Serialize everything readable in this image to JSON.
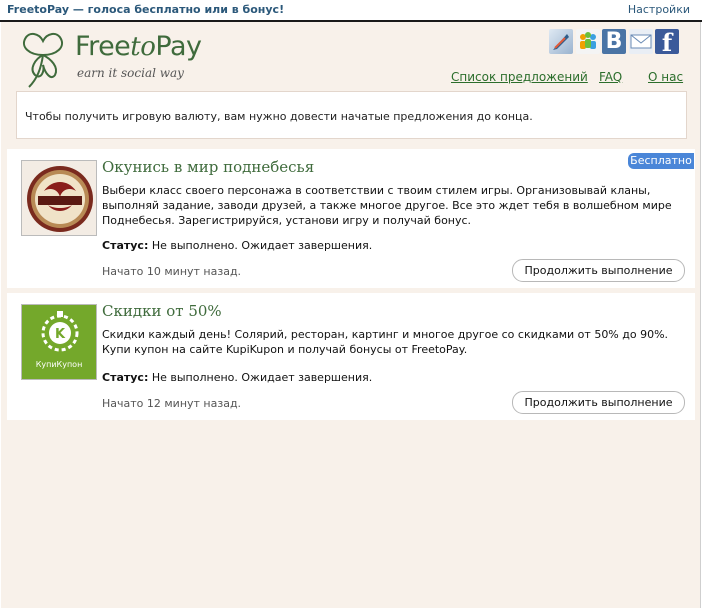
{
  "topbar": {
    "app_title": "FreetoPay — голоса бесплатно или в бонус!",
    "settings_link": "Настройки"
  },
  "header": {
    "logo_brand_prefix": "Free",
    "logo_brand_italic": "to",
    "logo_brand_suffix": "Pay",
    "logo_tagline": "earn it social way",
    "social_icons": [
      "feather-icon",
      "people-icon",
      "vk-icon",
      "mail-icon",
      "facebook-icon"
    ],
    "vk_letter": "B",
    "fb_letter": "f",
    "nav": {
      "offers": "Список предложений",
      "faq": "FAQ",
      "about": "О нас"
    }
  },
  "notice": "Чтобы получить игровую валюту, вам нужно довести начатые предложения до конца.",
  "offers": [
    {
      "badge": "Бесплатно",
      "title": "Окунись в мир поднебесья",
      "description": "Выбери класс своего персонажа в соответствии с твоим стилем игры. Организовывай кланы, выполняй задание, заводи друзей, а также многое другое. Все это ждет тебя в волшебном мире Поднебесья. Зарегистрируйся, установи игру и получай бонус.",
      "status_label": "Статус:",
      "status_value": "Не выполнено. Ожидает завершения.",
      "started": "Начато 10 минут назад.",
      "button": "Продолжить выполнение",
      "thumb_icon": "podnebesya-logo-icon"
    },
    {
      "title": "Скидки от 50%",
      "description": "Скидки каждый день! Солярий, ресторан, картинг и многое другое со скидками от 50% до 90%. Купи купон на сайте KupiKupon и получай бонусы от FreetoPay.",
      "status_label": "Статус:",
      "status_value": "Не выполнено. Ожидает завершения.",
      "started": "Начато 12 минут назад.",
      "button": "Продолжить выполнение",
      "thumb_icon": "kupikupon-logo-icon",
      "thumb_caption": "КупиКупон"
    }
  ],
  "colors": {
    "brand_green": "#3f6b3c",
    "link_green": "#2c6e2c",
    "badge_blue": "#4a86d8",
    "page_bg": "#f8f1ea",
    "topbar_text": "#2b587a"
  }
}
